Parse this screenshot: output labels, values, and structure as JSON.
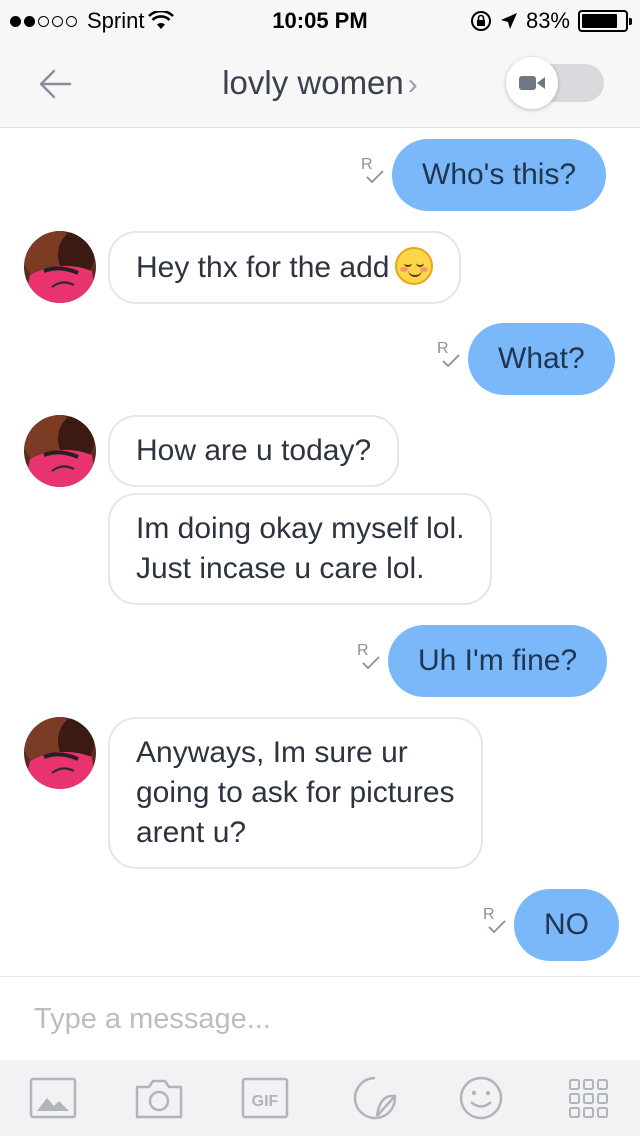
{
  "status_bar": {
    "carrier": "Sprint",
    "time": "10:05 PM",
    "battery_percent": "83%",
    "battery_level": 0.83,
    "signal_bars_filled": 2,
    "signal_bars_total": 5
  },
  "header": {
    "title": "lovly women",
    "title_chevron": "›",
    "back_icon": "arrow-left-icon",
    "video_icon": "video-camera-icon"
  },
  "messages": [
    {
      "direction": "outgoing",
      "text": "Who's this?",
      "read_receipt": "R"
    },
    {
      "direction": "incoming",
      "text": "Hey thx for the add",
      "emoji": "blushing-smile-emoji"
    },
    {
      "direction": "outgoing",
      "text": "What?",
      "read_receipt": "R"
    },
    {
      "direction": "incoming",
      "text": "How are u today?"
    },
    {
      "direction": "incoming",
      "lines": [
        "Im doing okay myself lol.",
        "Just incase u care lol."
      ]
    },
    {
      "direction": "outgoing",
      "text": "Uh I'm fine?",
      "read_receipt": "R"
    },
    {
      "direction": "incoming",
      "lines": [
        "Anyways, Im sure ur",
        "going to ask for pictures",
        "arent u?"
      ]
    },
    {
      "direction": "outgoing",
      "text": "NO",
      "read_receipt": "R"
    }
  ],
  "composer": {
    "placeholder": "Type a message...",
    "value": ""
  },
  "toolbar": {
    "gif_label": "GIF",
    "icons": [
      "image-icon",
      "camera-icon",
      "gif-icon",
      "sticker-icon",
      "smiley-icon",
      "grid-icon"
    ]
  },
  "colors": {
    "outgoing_bubble": "#7ab8fa",
    "incoming_border": "#e6e6e6",
    "header_bg": "#f7f7f7",
    "toolbar_bg": "#f2f2f4",
    "icon_gray": "#b0b4bb"
  }
}
